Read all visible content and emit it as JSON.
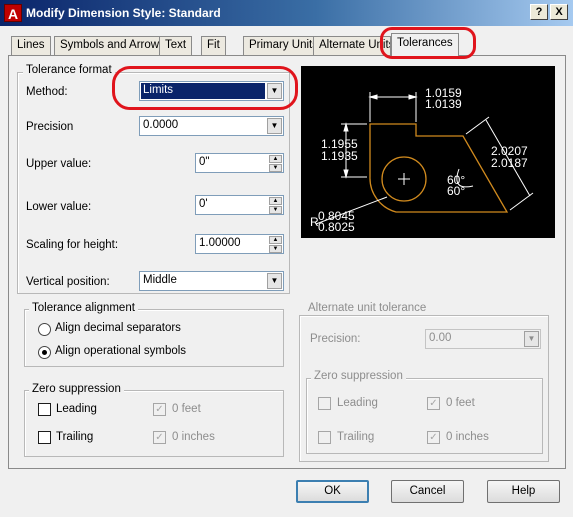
{
  "window": {
    "title": "Modify Dimension Style: Standard",
    "app_icon": "A",
    "help_btn": "?",
    "close_btn": "X"
  },
  "tabs": [
    {
      "label": "Lines"
    },
    {
      "label": "Symbols and Arrows"
    },
    {
      "label": "Text"
    },
    {
      "label": "Fit"
    },
    {
      "label": "Primary Units"
    },
    {
      "label": "Alternate Units"
    },
    {
      "label": "Tolerances",
      "active": true
    }
  ],
  "tolerance_format": {
    "title": "Tolerance format",
    "method": {
      "label": "Method:",
      "value": "Limits"
    },
    "precision": {
      "label": "Precision",
      "value": "0.0000"
    },
    "upper": {
      "label": "Upper value:",
      "value": "0\""
    },
    "lower": {
      "label": "Lower value:",
      "value": "0'"
    },
    "scaling": {
      "label": "Scaling for height:",
      "value": "1.00000"
    },
    "vertical": {
      "label": "Vertical position:",
      "value": "Middle"
    }
  },
  "tolerance_alignment": {
    "title": "Tolerance alignment",
    "options": [
      {
        "label": "Align decimal separators",
        "selected": false
      },
      {
        "label": "Align operational symbols",
        "selected": true
      }
    ]
  },
  "zero_suppression_left": {
    "title": "Zero suppression",
    "leading": {
      "label": "Leading",
      "checked": false
    },
    "trailing": {
      "label": "Trailing",
      "checked": false
    },
    "feet": {
      "label": "0 feet",
      "checked": true
    },
    "inches": {
      "label": "0 inches",
      "checked": true
    }
  },
  "alternate_unit_tolerance": {
    "title": "Alternate unit tolerance",
    "precision": {
      "label": "Precision:",
      "value": "0.00"
    }
  },
  "zero_suppression_right": {
    "title": "Zero suppression",
    "leading": {
      "label": "Leading",
      "checked": false
    },
    "trailing": {
      "label": "Trailing",
      "checked": false
    },
    "feet": {
      "label": "0 feet",
      "checked": true
    },
    "inches": {
      "label": "0 inches",
      "checked": true
    }
  },
  "preview": {
    "top_upper": "1.0159",
    "top_lower": "1.0139",
    "left_upper": "1.1955",
    "left_lower": "1.1935",
    "right_upper": "2.0207",
    "right_lower": "2.0187",
    "angle_upper": "60°",
    "angle_lower": "60°",
    "radius_prefix": "R",
    "radius_upper": "0.8045",
    "radius_lower": "0.8025"
  },
  "buttons": {
    "ok": "OK",
    "cancel": "Cancel",
    "help": "Help"
  },
  "colors": {
    "highlight": "#e0141c",
    "selection": "#0a246a",
    "preview_bg": "#000000",
    "preview_shape": "#d08a1e"
  }
}
